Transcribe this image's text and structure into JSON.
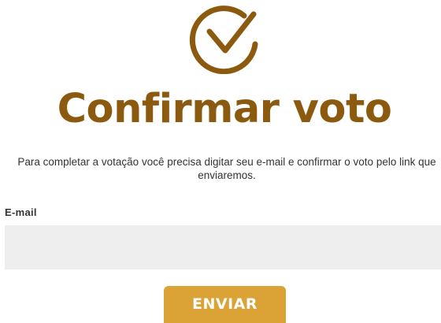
{
  "header": {
    "icon": "check-circle-icon",
    "title": "Confirmar voto"
  },
  "description": "Para completar a votação você precisa digitar seu e-mail e confirmar o voto pelo link que enviaremos.",
  "form": {
    "email_label": "E-mail",
    "email_value": "",
    "email_placeholder": "",
    "submit_label": "ENVIAR"
  },
  "colors": {
    "brand_brown": "#8c5a0f",
    "button_gold": "#dba236",
    "input_bg": "#eeeeee"
  }
}
